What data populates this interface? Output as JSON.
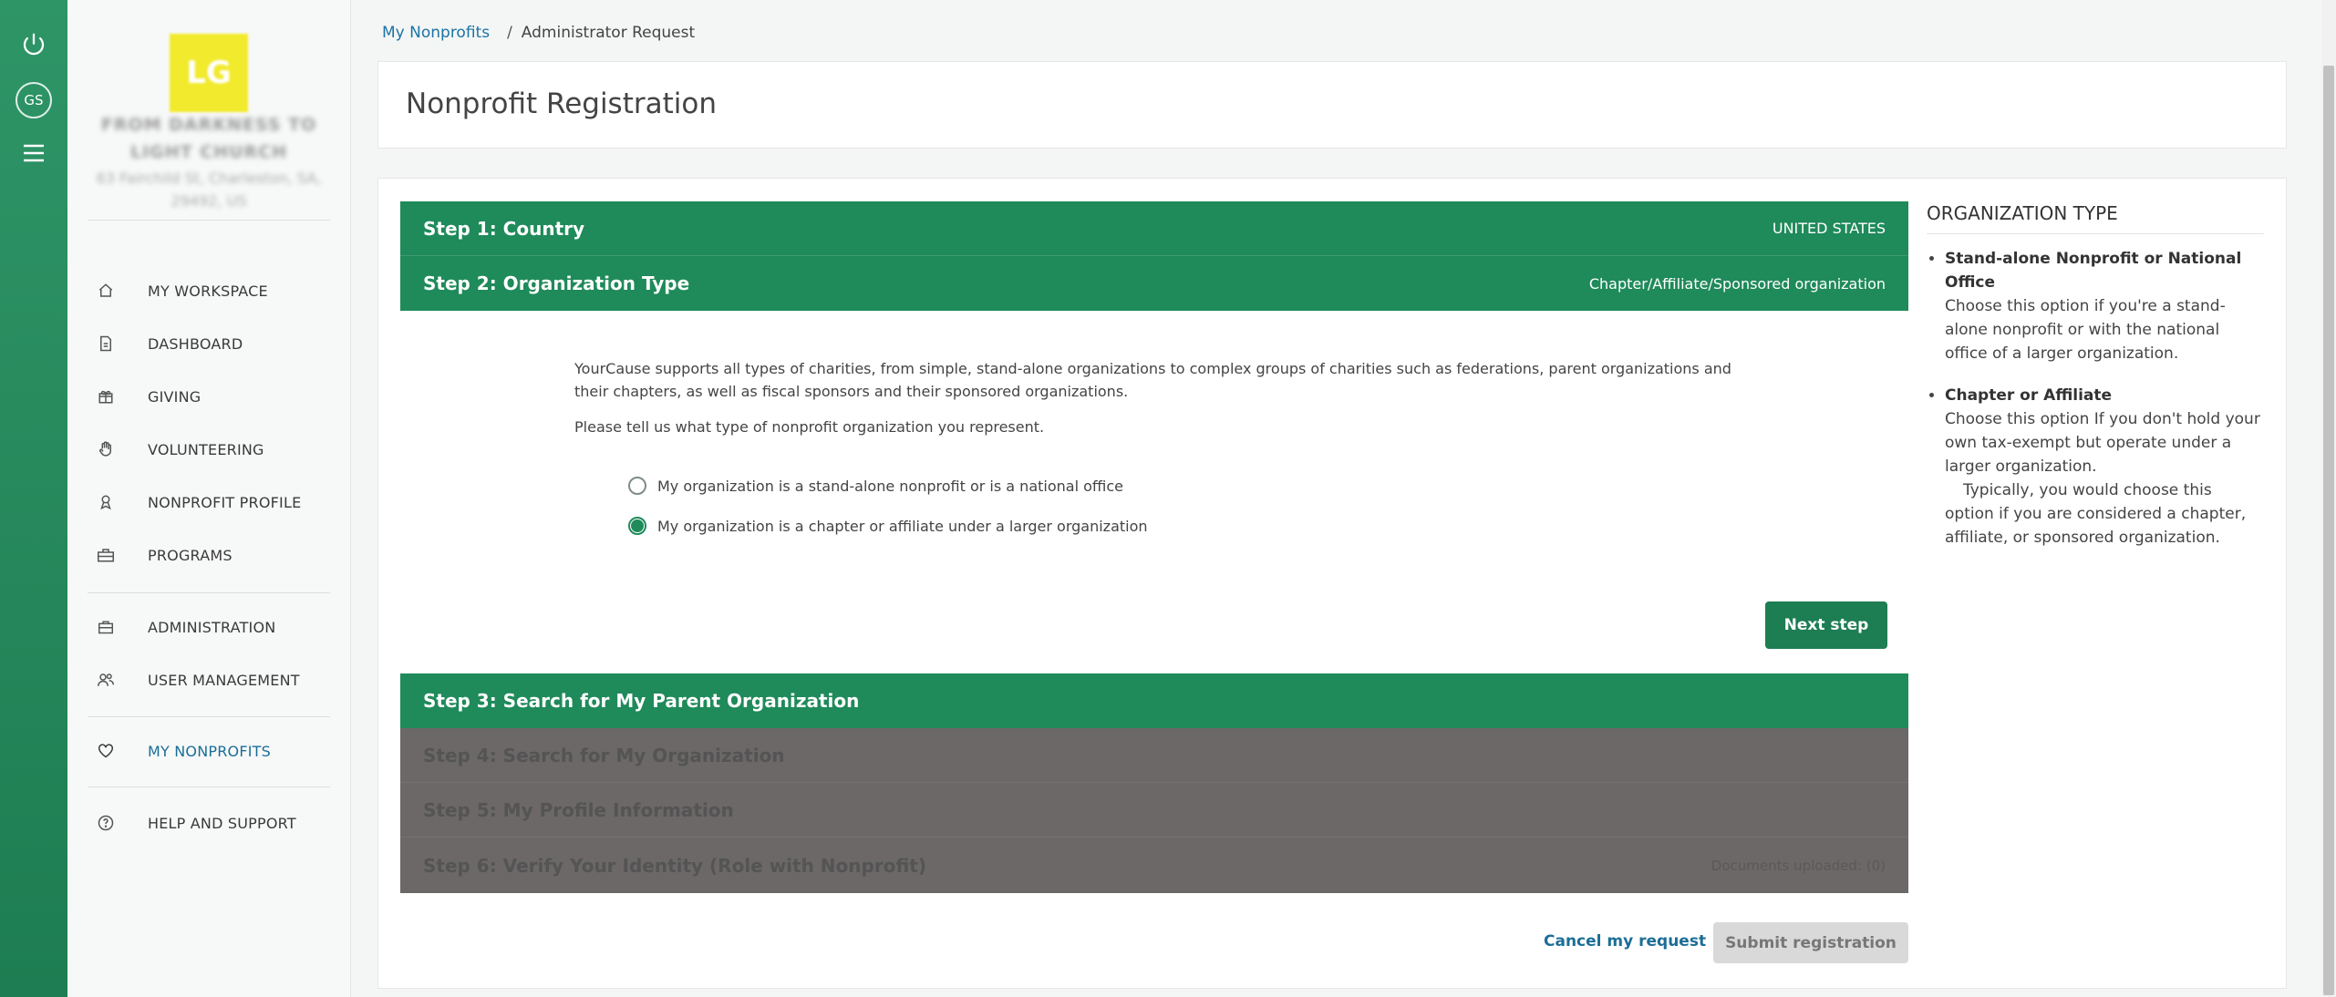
{
  "rail": {
    "avatar_initials": "GS"
  },
  "sidebar": {
    "org": {
      "logo_text": "LG",
      "name": "FROM DARKNESS TO LIGHT CHURCH",
      "address": "63 Fairchild St, Charleston, SA, 29492, US"
    },
    "nav": [
      {
        "label": "MY WORKSPACE",
        "icon": "home-icon"
      },
      {
        "label": "DASHBOARD",
        "icon": "document-icon"
      },
      {
        "label": "GIVING",
        "icon": "gift-icon"
      },
      {
        "label": "VOLUNTEERING",
        "icon": "hand-icon"
      },
      {
        "label": "NONPROFIT PROFILE",
        "icon": "ribbon-icon"
      },
      {
        "label": "PROGRAMS",
        "icon": "programs-icon"
      },
      {
        "label": "ADMINISTRATION",
        "icon": "briefcase-icon"
      },
      {
        "label": "USER MANAGEMENT",
        "icon": "users-icon"
      },
      {
        "label": "MY NONPROFITS",
        "icon": "heart-icon"
      },
      {
        "label": "HELP AND SUPPORT",
        "icon": "question-icon"
      }
    ],
    "active_item": "MY NONPROFITS"
  },
  "breadcrumb": {
    "link": "My Nonprofits",
    "separator": "/",
    "current": "Administrator Request"
  },
  "page_title": "Nonprofit Registration",
  "steps": {
    "s1": {
      "title": "Step 1: Country",
      "value": "UNITED STATES"
    },
    "s2": {
      "title": "Step 2: Organization Type",
      "value": "Chapter/Affiliate/Sponsored organization"
    },
    "s3": {
      "title": "Step 3: Search for My Parent Organization"
    },
    "s4": {
      "title": "Step 4: Search for My Organization"
    },
    "s5": {
      "title": "Step 5:  My Profile Information"
    },
    "s6": {
      "title": "Step 6: Verify Your Identity (Role with Nonprofit)",
      "value": "Documents uploaded: (0)"
    }
  },
  "org_type_form": {
    "intro": "YourCause supports all types of charities, from simple, stand-alone organizations to complex groups of charities such as federations, parent organizations and their chapters, as well as fiscal sponsors and their sponsored organizations.",
    "prompt": "Please tell us what type of nonprofit organization you represent.",
    "options": [
      {
        "label": "My organization is a stand-alone nonprofit or is a national office",
        "checked": false
      },
      {
        "label": "My organization is a chapter or affiliate under a larger organization",
        "checked": true
      }
    ],
    "next_label": "Next step"
  },
  "actions": {
    "cancel_label": "Cancel my request",
    "submit_label": "Submit registration"
  },
  "help": {
    "title": "ORGANIZATION TYPE",
    "items": [
      {
        "name": "Stand-alone Nonprofit or National Office",
        "text": "Choose this option if you're a stand-alone nonprofit or with the national office of a larger organization."
      },
      {
        "name": "Chapter or Affiliate",
        "text": "Choose this option If you don't hold your own tax-exempt but operate under a larger organization.",
        "extra": "Typically, you would choose this option if you are considered a chapter, affiliate, or sponsored organization."
      }
    ]
  },
  "colors": {
    "primary": "#1f8a5a",
    "link": "#1b6e96",
    "disabled_step": "#6b6867"
  }
}
